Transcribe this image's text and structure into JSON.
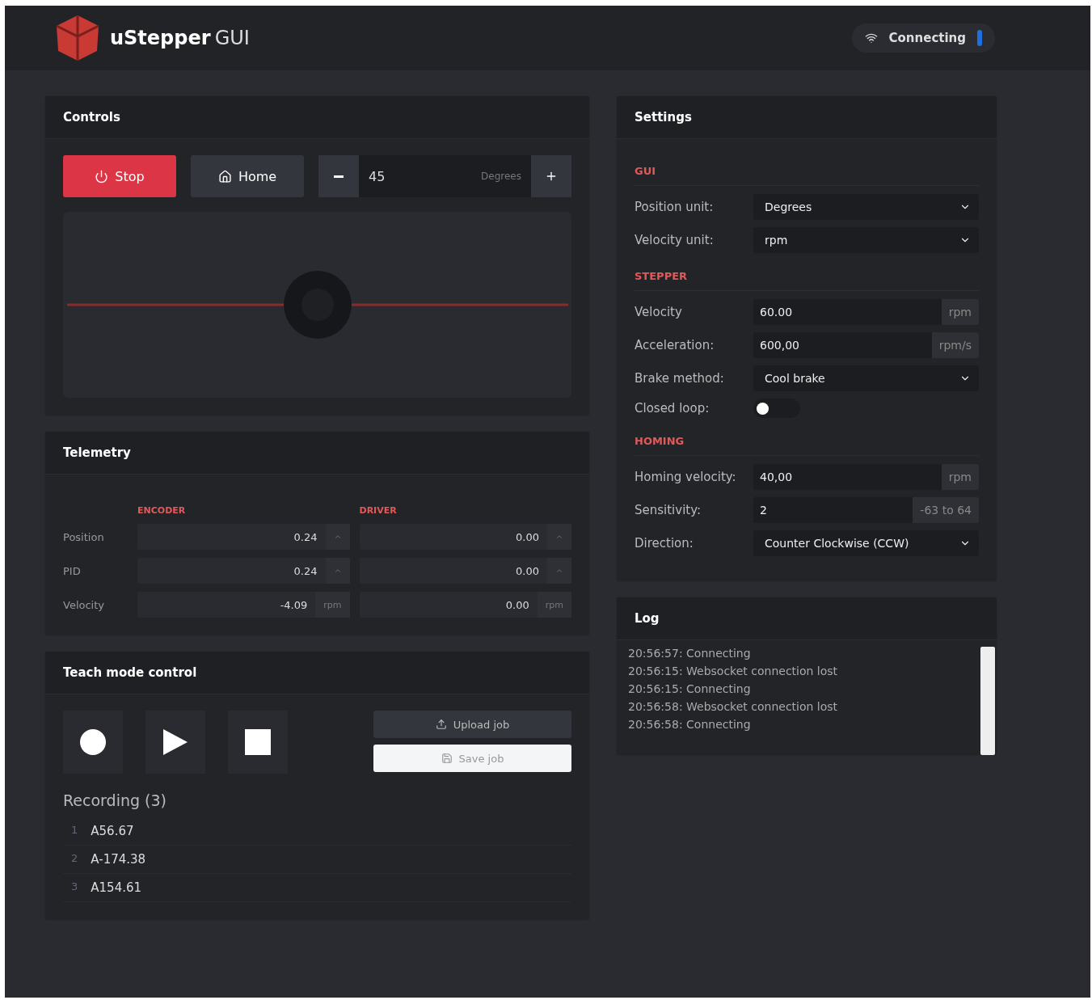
{
  "header": {
    "brand": "uStepper",
    "brand_suffix": "GUI",
    "status": "Connecting"
  },
  "controls": {
    "title": "Controls",
    "buttons": [
      {
        "label": "Stop",
        "kind": "danger"
      },
      {
        "label": "Home",
        "kind": "secondary"
      }
    ],
    "jog": {
      "value": "45",
      "unit": "Degrees"
    }
  },
  "telemetry": {
    "title": "Telemetry",
    "columns": [
      "ENCODER",
      "DRIVER"
    ],
    "rows": [
      {
        "label": "Position",
        "encoder": "0.24",
        "driver": "0.00"
      },
      {
        "label": "PID",
        "encoder": "0.24",
        "driver": "0.00"
      },
      {
        "label": "Velocity",
        "encoder": "-4.09",
        "encoder_unit": "rpm",
        "driver": "0.00",
        "driver_unit": "rpm"
      }
    ]
  },
  "teach": {
    "title": "Teach mode control",
    "upload": "Upload job",
    "save": "Save job",
    "recording_title": "Recording (3)",
    "recordings": [
      {
        "index": "1",
        "value": "A56.67"
      },
      {
        "index": "2",
        "value": "A-174.38"
      },
      {
        "index": "3",
        "value": "A154.61"
      }
    ]
  },
  "settings": {
    "title": "Settings",
    "sections": [
      {
        "heading": "GUI",
        "rows": [
          {
            "kind": "select",
            "label": "Position unit:",
            "value": "Degrees"
          },
          {
            "kind": "select",
            "label": "Velocity unit:",
            "value": "rpm"
          }
        ]
      },
      {
        "heading": "STEPPER",
        "rows": [
          {
            "kind": "input",
            "label": "Velocity",
            "value": "60.00",
            "unit": "rpm"
          },
          {
            "kind": "input",
            "label": "Acceleration:",
            "value": "600,00",
            "unit": "rpm/s"
          },
          {
            "kind": "select",
            "label": "Brake method:",
            "value": "Cool brake"
          },
          {
            "kind": "toggle",
            "label": "Closed loop:",
            "on": false
          }
        ]
      },
      {
        "heading": "HOMING",
        "rows": [
          {
            "kind": "input",
            "label": "Homing velocity:",
            "value": "40,00",
            "unit": "rpm"
          },
          {
            "kind": "input",
            "label": "Sensitivity:",
            "value": "2",
            "unit": "-63 to 64"
          },
          {
            "kind": "select",
            "label": "Direction:",
            "value": "Counter Clockwise (CCW)"
          }
        ]
      }
    ]
  },
  "log": {
    "title": "Log",
    "entries": [
      "20:56:57: Connecting",
      "20:56:15: Websocket connection lost",
      "20:56:15: Connecting",
      "20:56:58: Websocket connection lost",
      "20:56:58: Connecting"
    ]
  }
}
